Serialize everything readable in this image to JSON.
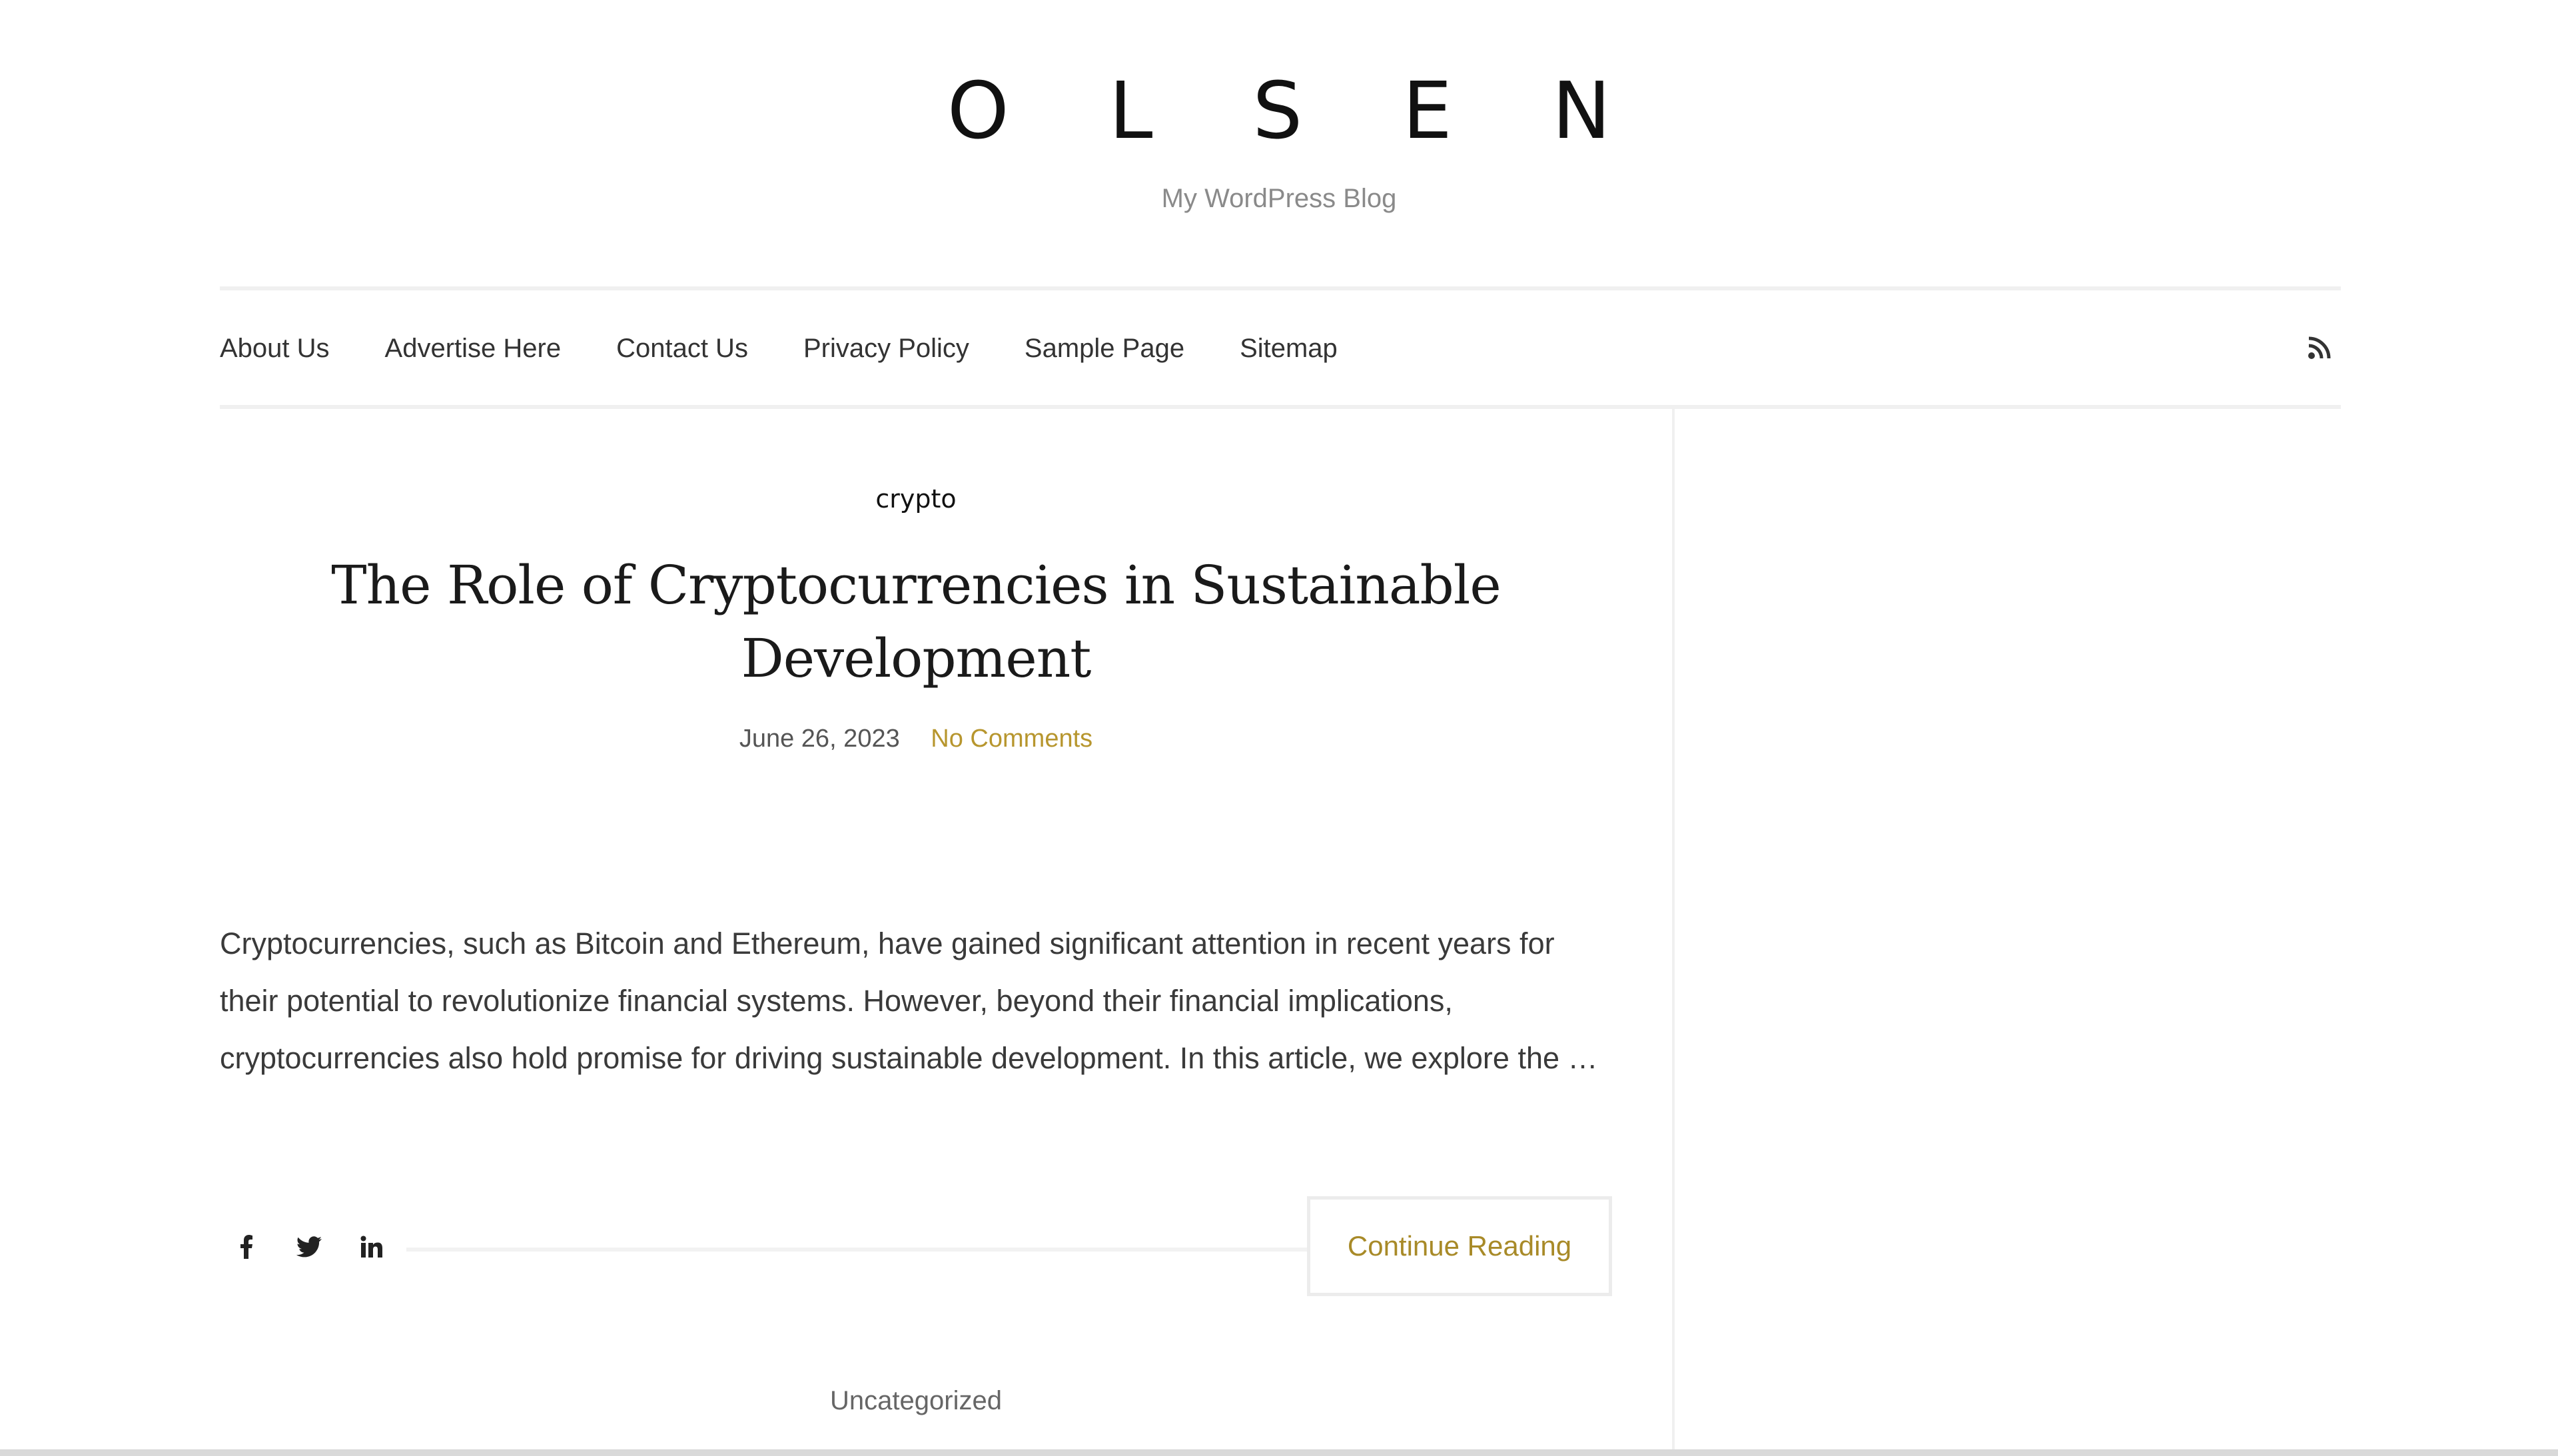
{
  "site": {
    "title": "OLSEN",
    "tagline": "My WordPress Blog"
  },
  "nav": {
    "items": [
      {
        "label": "About Us"
      },
      {
        "label": "Advertise Here"
      },
      {
        "label": "Contact Us"
      },
      {
        "label": "Privacy Policy"
      },
      {
        "label": "Sample Page"
      },
      {
        "label": "Sitemap"
      }
    ],
    "rss_icon": "rss-icon"
  },
  "post": {
    "category": "crypto",
    "title": "The Role of Cryptocurrencies in Sustainable Development",
    "date": "June 26, 2023",
    "comments": "No Comments",
    "excerpt": "Cryptocurrencies, such as Bitcoin and Ethereum, have gained significant attention in recent years for their potential to revolutionize financial systems. However, beyond their financial implications, cryptocurrencies also hold promise for driving sustainable development. In this article, we explore the …",
    "share_icons": [
      "facebook-icon",
      "twitter-icon",
      "linkedin-icon"
    ],
    "continue_label": "Continue Reading"
  },
  "next_post": {
    "category": "Uncategorized"
  },
  "colors": {
    "accent": "#b7962e",
    "text": "#222222",
    "muted": "#8a8a8a",
    "divider": "#f0f0f0"
  }
}
